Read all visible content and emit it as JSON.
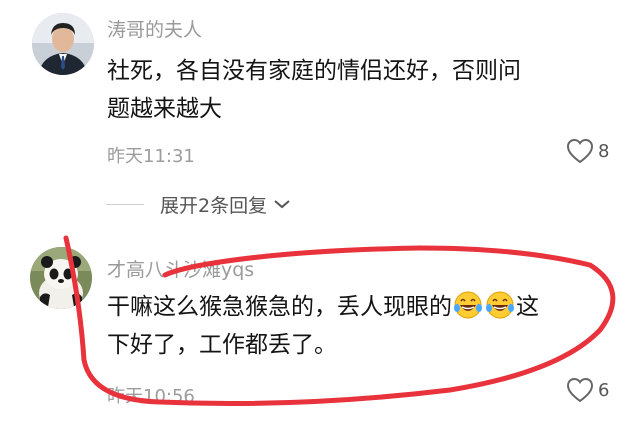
{
  "comments": [
    {
      "username": "涛哥的夫人",
      "text_line1": "社死，各自没有家庭的情侣还好，否则问",
      "text_line2": "题越来越大",
      "time": "昨天11:31",
      "likes": "8"
    },
    {
      "username": "才高八斗沙滩yqs",
      "text_line1": "干嘛这么猴急猴急的，丢人现眼的",
      "text_line1_tail": "这",
      "text_line2": "下好了，工作都丢了。",
      "time": "昨天10:56",
      "likes": "6"
    }
  ],
  "replies": {
    "expand_label": "展开2条回复"
  },
  "icons": {
    "like": "heart-outline-icon",
    "expand": "chevron-down-icon",
    "emoji": "laughing-tears-emoji"
  },
  "colors": {
    "annotation_stroke": "#e8323c",
    "muted_text": "#9a9a9a"
  }
}
